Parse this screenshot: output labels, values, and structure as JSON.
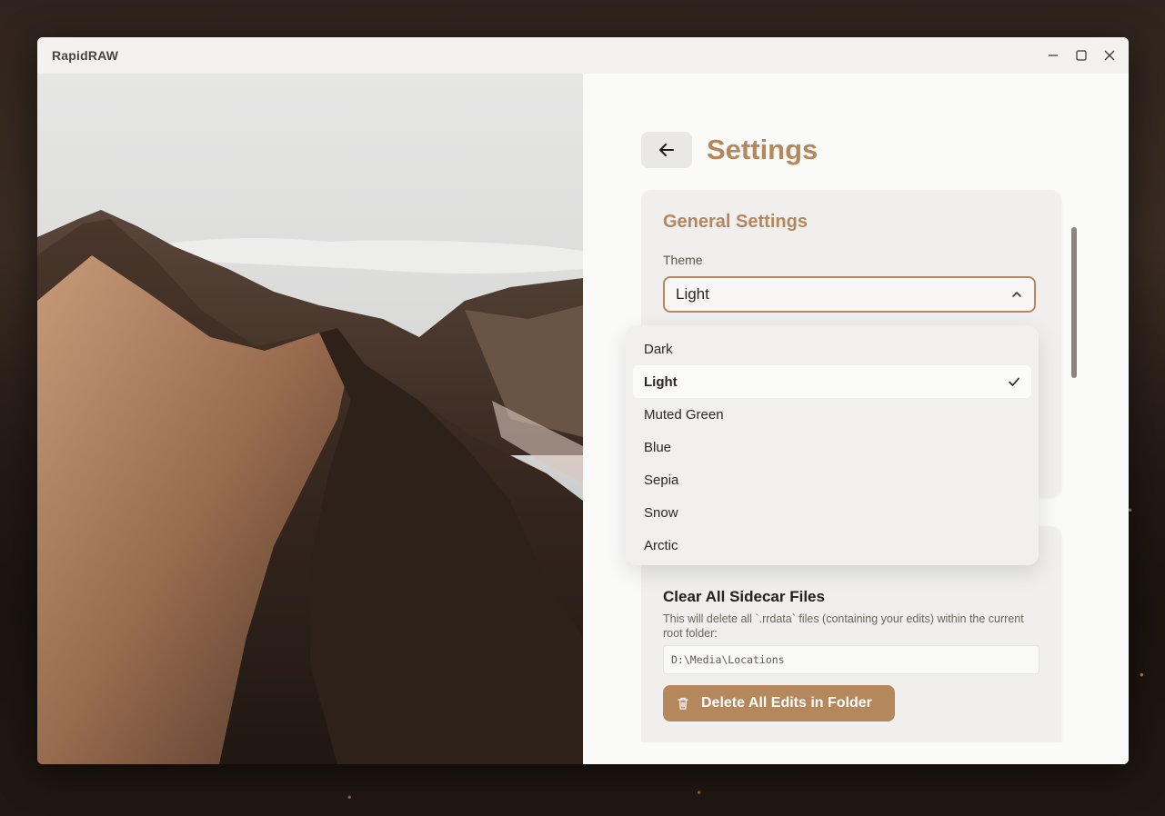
{
  "app": {
    "title": "RapidRAW"
  },
  "settings": {
    "title": "Settings",
    "general": {
      "title": "General Settings",
      "theme_label": "Theme",
      "theme_value": "Light",
      "theme_options": [
        "Dark",
        "Light",
        "Muted Green",
        "Blue",
        "Sepia",
        "Snow",
        "Arctic"
      ],
      "selected_index": 1
    },
    "data": {
      "sidecar_title": "Clear All Sidecar Files",
      "sidecar_desc": "This will delete all `.rrdata` files (containing your edits) within the current root folder:",
      "root_path": "D:\\Media\\Locations",
      "delete_button": "Delete All Edits in Folder"
    }
  },
  "colors": {
    "accent": "#b5875d",
    "panel": "#fafaf9",
    "card": "#f0efed"
  },
  "icons": {
    "back": "arrow-left-icon",
    "chevron": "chevron-up-icon",
    "check": "check-icon",
    "trash": "trash-icon",
    "minimize": "minimize-icon",
    "maximize": "maximize-icon",
    "close": "close-icon"
  }
}
